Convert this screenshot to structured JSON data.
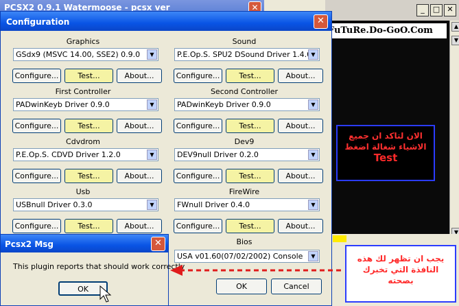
{
  "bg_window": {
    "title": "PCSX2 0.9.1 Watermoose - pcsx ver"
  },
  "right_window": {
    "min": "_",
    "max": "□",
    "close": "✕"
  },
  "watermark": "WwW.FuTuRe.Do-GoO.Com",
  "note_top": {
    "line1": "الان لتاكد ان جميع",
    "line2": "الاشياء شغالة اضغط",
    "line3": "Test"
  },
  "note_bottom": {
    "line1": "يجب ان تظهر لك هذه",
    "line2": "النافذة التي تخبرك",
    "line3": "بصحته"
  },
  "config": {
    "title": "Configuration",
    "close": "✕",
    "groups": [
      {
        "label": "Graphics",
        "value": "GSdx9 (MSVC 14.00, SSE2) 0.9.0"
      },
      {
        "label": "Sound",
        "value": "P.E.Op.S. SPU2 DSound Driver 1.4.0"
      },
      {
        "label": "First Controller",
        "value": "PADwinKeyb Driver 0.9.0"
      },
      {
        "label": "Second Controller",
        "value": "PADwinKeyb Driver 0.9.0"
      },
      {
        "label": "Cdvdrom",
        "value": "P.E.Op.S. CDVD Driver 1.2.0"
      },
      {
        "label": "Dev9",
        "value": "DEV9null Driver 0.2.0"
      },
      {
        "label": "Usb",
        "value": "USBnull Driver 0.3.0"
      },
      {
        "label": "FireWire",
        "value": "FWnull Driver 0.4.0"
      },
      {
        "label": "Bios",
        "value": "USA    v01.60(07/02/2002) Console"
      }
    ],
    "buttons": {
      "configure": "Configure...",
      "test": "Test...",
      "about": "About..."
    },
    "ok": "OK",
    "cancel": "Cancel"
  },
  "msg": {
    "title": "Pcsx2 Msg",
    "close": "✕",
    "text": "This plugin reports that should work correctly",
    "ok": "OK"
  }
}
